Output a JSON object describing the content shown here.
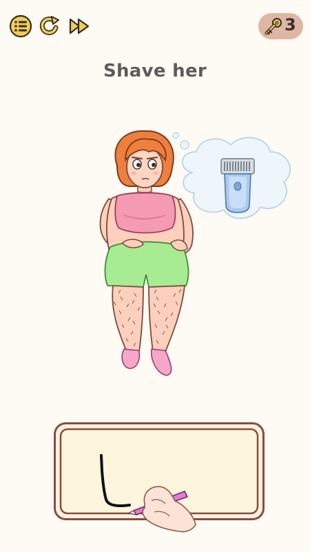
{
  "level": {
    "title": "Shave her"
  },
  "toolbar": {
    "menu_icon": "list-icon",
    "restart_icon": "restart-icon",
    "skip_icon": "fast-forward-icon"
  },
  "keys": {
    "icon": "key-icon",
    "count": "3"
  },
  "scene": {
    "character": "woman-character",
    "thought_item": "electric-shaver-icon"
  },
  "colors": {
    "background": "#fdfbf3",
    "toolbar_icon": "#f4cd4f",
    "key_badge": "#ddb7a3",
    "title_text": "#5d5c5b",
    "drawpad_border": "#8b4a42",
    "drawpad_fill": "#fdf6dc",
    "pen": "#e67ad6"
  }
}
